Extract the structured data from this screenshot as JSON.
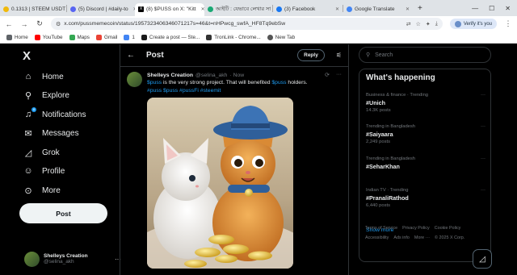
{
  "browser": {
    "tabs": [
      {
        "title": "0.1313 | STEEM USDT",
        "color": "#f0b90b",
        "active": false
      },
      {
        "title": "(5) Discord | #daily-to",
        "color": "#5865f2",
        "active": false
      },
      {
        "title": "(8) $PUSS on X: \"Kitt",
        "color": "#000000",
        "active": true
      },
      {
        "title": "আইটি : যেভাবে লেখার সা",
        "color": "#19a974",
        "active": false
      },
      {
        "title": "(3) Facebook",
        "color": "#1877f2",
        "active": false
      },
      {
        "title": "Google Translate",
        "color": "#4285f4",
        "active": false
      }
    ],
    "new_tab": "+",
    "url": "x.com/pussmemecoin/status/1957323406346071217s=46&t=nHPwcg_swfA_HF8Tq9ebSw",
    "verify_label": "Verify it's you",
    "bookmarks": [
      {
        "label": "Home",
        "color": "#5f6368"
      },
      {
        "label": "YouTube",
        "color": "#ff0000"
      },
      {
        "label": "Maps",
        "color": "#34a853"
      },
      {
        "label": "Gmail",
        "color": "#ea4335"
      },
      {
        "label": "1",
        "color": "#4285f4"
      },
      {
        "label": "Create a post — Ste...",
        "color": "#1a1a1a"
      },
      {
        "label": "TronLink - Chrome...",
        "color": "#333333"
      },
      {
        "label": "New Tab",
        "color": "#555555"
      }
    ]
  },
  "sidebar": {
    "logo": "X",
    "items": [
      {
        "label": "Home",
        "icon": "home-icon",
        "glyph": "⌂"
      },
      {
        "label": "Explore",
        "icon": "search-icon",
        "glyph": "⚲"
      },
      {
        "label": "Notifications",
        "icon": "bell-icon",
        "glyph": "🔔",
        "badge": "8"
      },
      {
        "label": "Messages",
        "icon": "mail-icon",
        "glyph": "✉"
      },
      {
        "label": "Grok",
        "icon": "grok-icon",
        "glyph": "◿"
      },
      {
        "label": "Profile",
        "icon": "person-icon",
        "glyph": "☺"
      },
      {
        "label": "More",
        "icon": "more-circle-icon",
        "glyph": "⊙"
      }
    ],
    "post_label": "Post",
    "account": {
      "display_name": "Shelleys Creation",
      "handle": "@selina_akh",
      "more": "···"
    }
  },
  "main": {
    "header_title": "Post",
    "reply_label": "Reply",
    "tweet": {
      "name": "Shelleys Creation",
      "handle": "@selina_akh",
      "time": "· Now",
      "text_link1": "$puss",
      "text_mid": " is the very strong project. That will benefited ",
      "text_link2": "$puss",
      "text_end": " holders.",
      "hashtags": "#puss $puss #pussFi #steemit"
    }
  },
  "right": {
    "search_placeholder": "Search",
    "trends_title": "What's happening",
    "trends": [
      {
        "context": "Business & finance · Trending",
        "name": "#Unich",
        "count": "14.3K posts"
      },
      {
        "context": "Trending in Bangladesh",
        "name": "#Saiyaara",
        "count": "2,249 posts"
      },
      {
        "context": "Trending in Bangladesh",
        "name": "#SeharKhan",
        "count": ""
      },
      {
        "context": "Indian TV · Trending",
        "name": "#PranaliRathod",
        "count": "6,440 posts"
      }
    ],
    "show_more": "Show more",
    "footer": [
      "Terms of Service",
      "Privacy Policy",
      "Cookie Policy",
      "Accessibility",
      "Ads info",
      "More ···",
      "© 2025 X Corp."
    ]
  }
}
